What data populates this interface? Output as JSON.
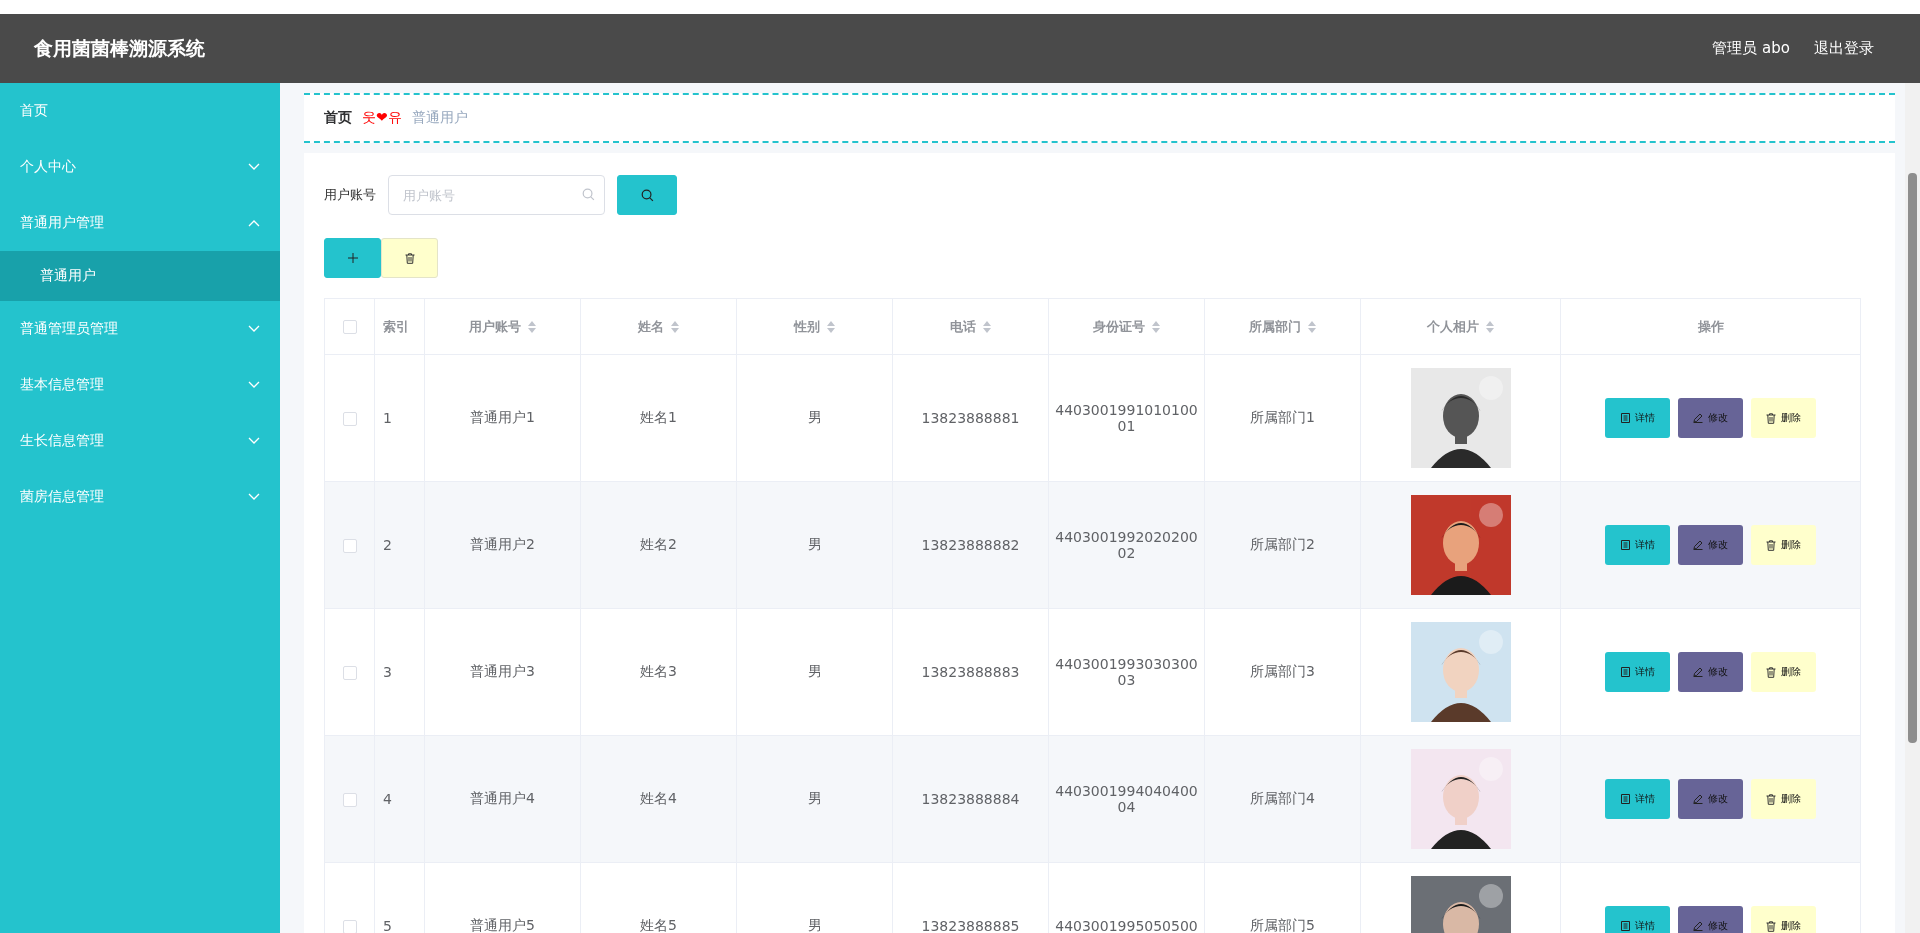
{
  "header": {
    "title": "食用菌菌棒溯源系统",
    "user": "管理员 abo",
    "logout": "退出登录"
  },
  "sidebar": {
    "items": [
      {
        "label": "首页",
        "kind": "link"
      },
      {
        "label": "个人中心",
        "kind": "menu",
        "expanded": false
      },
      {
        "label": "普通用户管理",
        "kind": "menu",
        "expanded": true,
        "children": [
          {
            "label": "普通用户",
            "selected": true
          }
        ]
      },
      {
        "label": "普通管理员管理",
        "kind": "menu",
        "expanded": false
      },
      {
        "label": "基本信息管理",
        "kind": "menu",
        "expanded": false
      },
      {
        "label": "生长信息管理",
        "kind": "menu",
        "expanded": false
      },
      {
        "label": "菌房信息管理",
        "kind": "menu",
        "expanded": false
      }
    ]
  },
  "breadcrumb": {
    "home": "首页",
    "separator": "웃❤유",
    "current": "普通用户"
  },
  "search": {
    "label": "用户账号",
    "placeholder": "用户账号"
  },
  "table": {
    "select_all": {
      "checked": false
    },
    "columns": [
      {
        "label": "索引",
        "sortable": false
      },
      {
        "label": "用户账号",
        "sortable": true
      },
      {
        "label": "姓名",
        "sortable": true
      },
      {
        "label": "性别",
        "sortable": true
      },
      {
        "label": "电话",
        "sortable": true
      },
      {
        "label": "身份证号",
        "sortable": true
      },
      {
        "label": "所属部门",
        "sortable": true
      },
      {
        "label": "个人相片",
        "sortable": true
      },
      {
        "label": "操作",
        "sortable": false
      }
    ],
    "rows": [
      {
        "checked": false,
        "cells": [
          "1",
          "普通用户1",
          "姓名1",
          "男",
          "13823888881",
          "440300199101010001",
          "所属部门1"
        ],
        "actions": [
          {
            "kind": "detail",
            "label": "详情"
          },
          {
            "kind": "edit",
            "label": "修改"
          },
          {
            "kind": "delete",
            "label": "删除"
          }
        ]
      },
      {
        "checked": false,
        "cells": [
          "2",
          "普通用户2",
          "姓名2",
          "男",
          "13823888882",
          "440300199202020002",
          "所属部门2"
        ],
        "actions": [
          {
            "kind": "detail",
            "label": "详情"
          },
          {
            "kind": "edit",
            "label": "修改"
          },
          {
            "kind": "delete",
            "label": "删除"
          }
        ]
      },
      {
        "checked": false,
        "cells": [
          "3",
          "普通用户3",
          "姓名3",
          "男",
          "13823888883",
          "440300199303030003",
          "所属部门3"
        ],
        "actions": [
          {
            "kind": "detail",
            "label": "详情"
          },
          {
            "kind": "edit",
            "label": "修改"
          },
          {
            "kind": "delete",
            "label": "删除"
          }
        ]
      },
      {
        "checked": false,
        "cells": [
          "4",
          "普通用户4",
          "姓名4",
          "男",
          "13823888884",
          "440300199404040004",
          "所属部门4"
        ],
        "actions": [
          {
            "kind": "detail",
            "label": "详情"
          },
          {
            "kind": "edit",
            "label": "修改"
          },
          {
            "kind": "delete",
            "label": "删除"
          }
        ]
      },
      {
        "checked": false,
        "cells": [
          "5",
          "普通用户5",
          "姓名5",
          "男",
          "13823888885",
          "4403001995050500",
          "所属部门5"
        ],
        "actions": [
          {
            "kind": "detail",
            "label": "详情"
          },
          {
            "kind": "edit",
            "label": "修改"
          },
          {
            "kind": "delete",
            "label": "删除"
          }
        ]
      }
    ]
  }
}
